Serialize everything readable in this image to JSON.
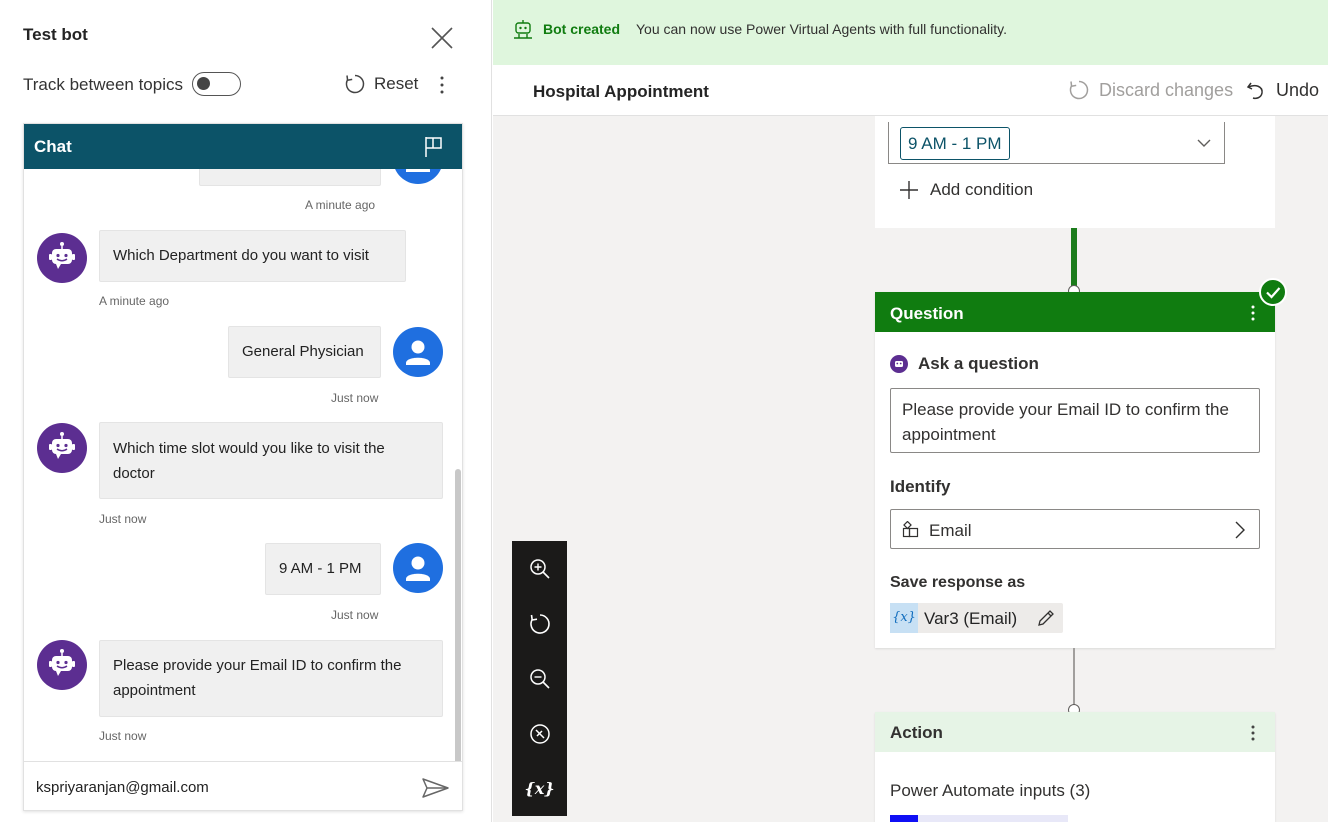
{
  "test_bot": {
    "title": "Test bot",
    "track_label": "Track between topics",
    "reset_label": "Reset"
  },
  "chat": {
    "title": "Chat",
    "messages": [
      {
        "from": "user",
        "text": "",
        "time": "A minute ago"
      },
      {
        "from": "bot",
        "text": "Which Department do you want to visit",
        "time": "A minute ago"
      },
      {
        "from": "user",
        "text": "General Physician",
        "time": "Just now"
      },
      {
        "from": "bot",
        "text": "Which time slot would you like to visit the doctor",
        "time": "Just now"
      },
      {
        "from": "user",
        "text": "9 AM - 1 PM",
        "time": "Just now"
      },
      {
        "from": "bot",
        "text": "Please provide your Email ID to confirm the appointment",
        "time": "Just now"
      }
    ],
    "input_value": "kspriyaranjan@gmail.com"
  },
  "banner": {
    "title": "Bot created",
    "text": "You can now use Power Virtual Agents with full functionality."
  },
  "toolbar": {
    "topic_name": "Hospital Appointment",
    "discard_label": "Discard changes",
    "undo_label": "Undo"
  },
  "condition": {
    "selected_value": "9 AM - 1 PM",
    "add_label": "Add condition"
  },
  "question_node": {
    "title": "Question",
    "ask_label": "Ask a question",
    "ask_text": "Please provide your Email ID to confirm the appointment",
    "identify_label": "Identify",
    "identify_value": "Email",
    "save_label": "Save response as",
    "var_icon": "{x}",
    "var_name": "Var3 (Email)"
  },
  "action_node": {
    "title": "Action",
    "inputs_label": "Power Automate inputs (3)"
  },
  "zoom": {
    "variables_label": "{x}"
  },
  "colors": {
    "chat_header": "#0c5368",
    "bot_avatar": "#5c2e91",
    "user_avatar": "#1f6fe0",
    "question_header": "#107c10",
    "banner_bg": "#dff6dd",
    "zoom_toolbar": "#1b1a19"
  },
  "icons": {
    "close": "close-icon",
    "reset": "refresh-icon",
    "more": "more-vertical-icon",
    "flag": "flag-icon",
    "send": "send-icon",
    "bot_avatar": "bot-face-icon",
    "user_avatar": "person-icon",
    "banner": "bot-check-icon",
    "discard": "refresh-icon",
    "undo": "undo-icon",
    "chevron_down": "chevron-down-icon",
    "add": "plus-icon",
    "checkmark": "checkmark-icon",
    "identify": "entity-icon",
    "chevron_right": "chevron-right-icon",
    "edit": "pencil-icon",
    "zoom_in": "zoom-in-icon",
    "fit": "refresh-icon",
    "zoom_out": "zoom-out-icon",
    "minimap": "compass-icon"
  }
}
